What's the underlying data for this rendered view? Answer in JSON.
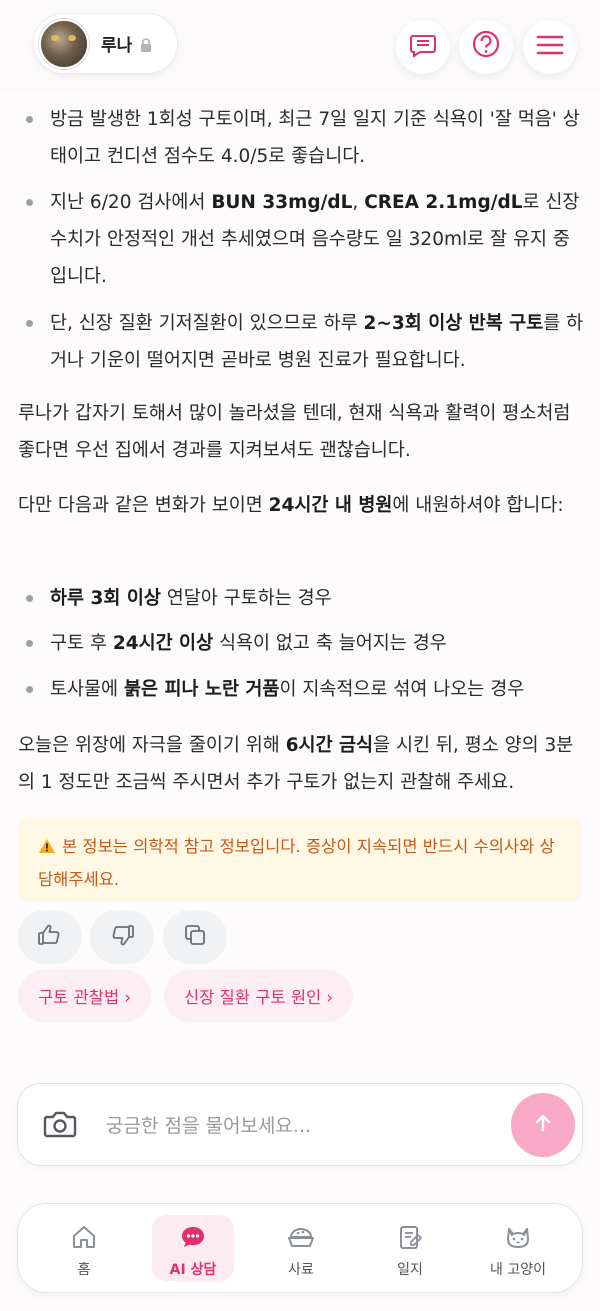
{
  "header": {
    "pet_name": "루나",
    "icons": [
      "lock-icon",
      "chat-list-icon",
      "help-icon",
      "menu-icon"
    ]
  },
  "message": {
    "bullets_top": [
      [
        "방금 발생한 1회성 구토이며, 최근 7일 일지 기준 식욕이 '잘 먹음' 상태이고 컨디션 점수도 4.0/5로 좋습니다."
      ],
      [
        "지난 6/20 검사에서 ",
        "BUN 33mg/dL",
        ", ",
        "CREA 2.1mg/dL",
        "로 신장 수치가 안정적인 개선 추세였으며 음수량도 일 320ml로 잘 유지 중입니다."
      ],
      [
        "단, 신장 질환 기저질환이 있으므로 하루 ",
        "2~3회 이상 반복 구토",
        "를 하거나 기운이 떨어지면 곧바로 병원 진료가 필요합니다."
      ]
    ],
    "para1": "루나가 갑자기 토해서 많이 놀라셨을 텐데, 현재 식욕과 활력이 평소처럼 좋다면 우선 집에서 경과를 지켜보셔도 괜찮습니다.",
    "para2": [
      "다만 다음과 같은 변화가 보이면 ",
      "24시간 내 병원",
      "에 내원하셔야 합니다:"
    ],
    "bullets_bottom": [
      [
        "",
        "하루 3회 이상",
        " 연달아 구토하는 경우"
      ],
      [
        "구토 후 ",
        "24시간 이상",
        " 식욕이 없고 축 늘어지는 경우"
      ],
      [
        "토사물에 ",
        "붉은 피나 노란 거품",
        "이 지속적으로 섞여 나오는 경우"
      ]
    ],
    "para3": [
      "오늘은 위장에 자극을 줄이기 위해 ",
      "6시간 금식",
      "을 시킨 뒤, 평소 양의 3분의 1 정도만 조금씩 주시면서 추가 구토가 없는지 관찰해 주세요."
    ],
    "notice": "본 정보는 의학적 참고 정보입니다. 증상이 지속되면 반드시 수의사와 상담해주세요.",
    "feedback_icons": [
      "thumbs-up-icon",
      "thumbs-down-icon",
      "copy-icon"
    ]
  },
  "suggestions": [
    "구토 관찰법 ›",
    "신장 질환 구토 원인 ›"
  ],
  "input": {
    "placeholder": "궁금한 점을 물어보세요...",
    "value": ""
  },
  "nav": {
    "items": [
      {
        "label": "홈",
        "icon": "home-icon"
      },
      {
        "label": "AI 상담",
        "icon": "chat-bubble-icon",
        "active": true
      },
      {
        "label": "사료",
        "icon": "food-bowl-icon"
      },
      {
        "label": "일지",
        "icon": "journal-icon"
      },
      {
        "label": "내 고양이",
        "icon": "cat-icon"
      }
    ]
  },
  "colors": {
    "accent": "#e0316f",
    "accent_light": "#fdebf2",
    "notice_bg": "#fff8e4",
    "notice_text": "#c75a1b",
    "send_button": "#f7a9c6"
  }
}
